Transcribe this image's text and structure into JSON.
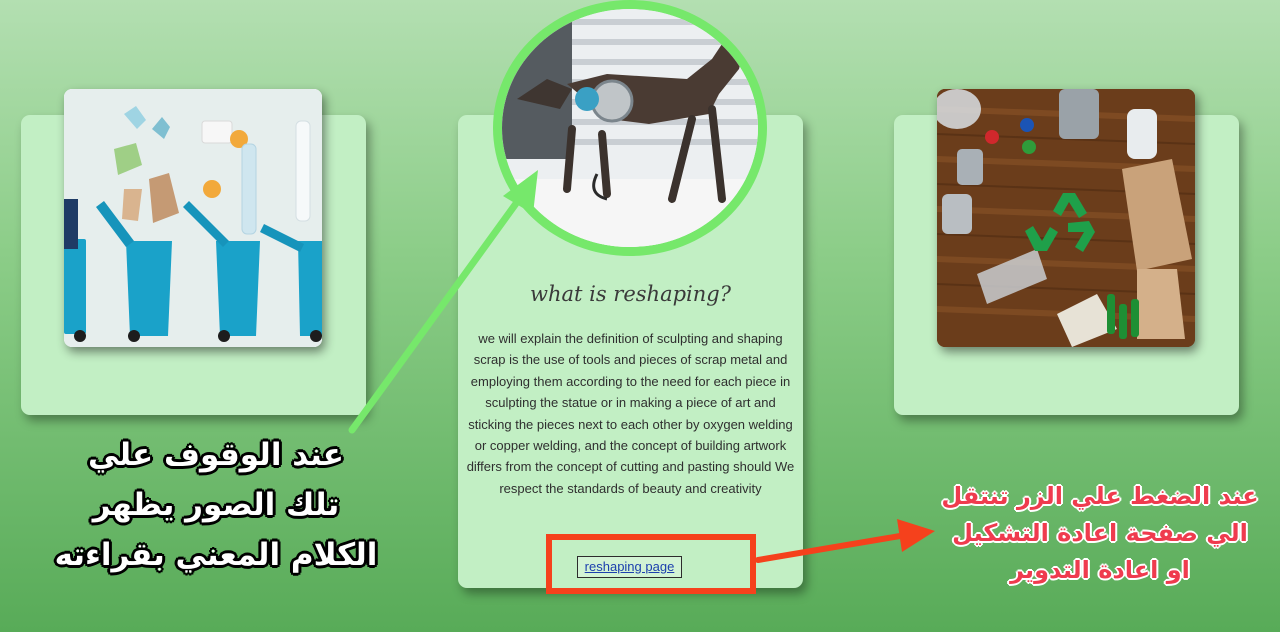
{
  "cards": {
    "center": {
      "title": "what is reshaping?",
      "text": "we will explain the definition of sculpting and shaping scrap is the use of tools and pieces of scrap metal and employing them according to the need for each piece in sculpting the statue or in making a piece of art and sticking the pieces next to each other by oxygen welding or copper welding, and the concept of building artwork differs from the concept of cutting and pasting should We respect the standards of beauty and creativity",
      "button_label": "reshaping page"
    }
  },
  "annotations": {
    "hover_note": [
      "عند الوقوف علي",
      "تلك الصور يظهر",
      "الكلام المعني بقراءته"
    ],
    "click_note": [
      "عند الضغط علي الزر تنتقل",
      "الي صفحة اعادة التشكيل",
      "او اعادة التدوير"
    ]
  },
  "colors": {
    "card_background": "#c2efc4",
    "highlight_arrow_green": "#76e86b",
    "highlight_box_red": "#f5411c",
    "click_note_text": "#ef3b4e",
    "link_text": "#1c3fae"
  },
  "images": {
    "left": "recycling-bins-with-waste-photo",
    "center": "scrap-metal-horse-sculpture-photo",
    "right": "recyclables-on-wooden-table-photo"
  }
}
